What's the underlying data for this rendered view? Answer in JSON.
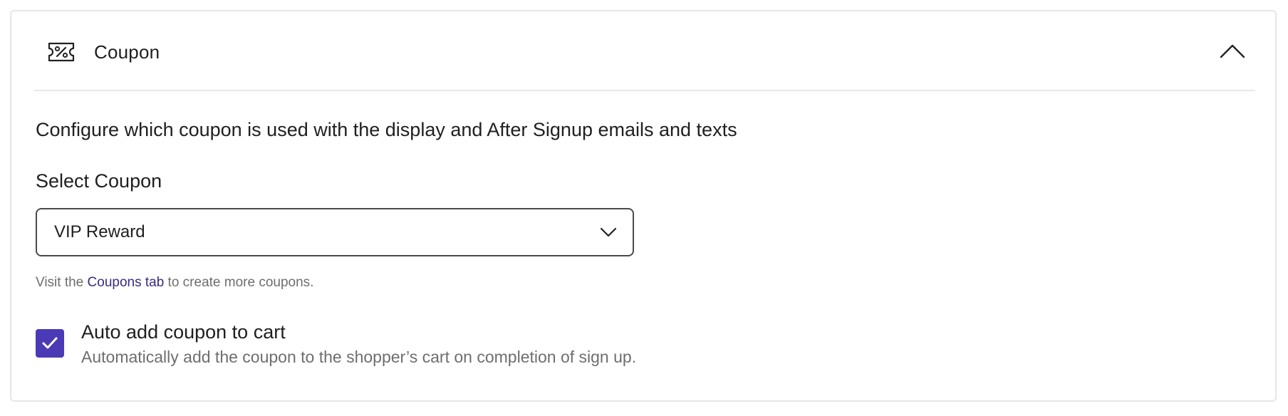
{
  "section": {
    "title": "Coupon",
    "icon": "coupon-ticket-icon",
    "toggle_icon": "chevron-up-icon",
    "description": "Configure which coupon is used with the display and After Signup emails and texts"
  },
  "select_coupon": {
    "label": "Select Coupon",
    "selected_value": "VIP Reward",
    "dropdown_icon": "chevron-down-icon"
  },
  "hint": {
    "prefix": "Visit the ",
    "link_text": "Coupons tab",
    "suffix": " to create more coupons."
  },
  "auto_add": {
    "checked": true,
    "label": "Auto add coupon to cart",
    "description": "Automatically add the coupon to the shopper’s cart on completion of sign up."
  },
  "colors": {
    "accent": "#4b3ab5",
    "link": "#3a2a86",
    "muted_text": "#6e6e6e",
    "border": "#e6e6e6"
  }
}
